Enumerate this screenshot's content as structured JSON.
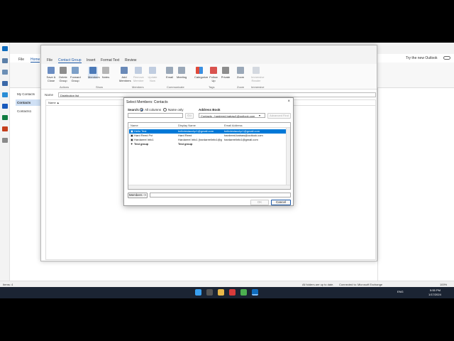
{
  "background": {
    "tabs": [
      "File",
      "Home"
    ],
    "try_new": "Try the new Outlook",
    "nav": {
      "my_contacts": "My Contacts",
      "contacts": "Contacts",
      "contacts1": "Contacts1"
    }
  },
  "contact_group_window": {
    "tabs": [
      "File",
      "Contact Group",
      "Insert",
      "Format Text",
      "Review"
    ],
    "ribbon_buttons": [
      {
        "label": "Save & Close"
      },
      {
        "label": "Delete Group"
      },
      {
        "label": "Forward Group"
      },
      {
        "label": "Members"
      },
      {
        "label": "Notes"
      },
      {
        "label": "Add Members"
      },
      {
        "label": "Remove Member"
      },
      {
        "label": "Update Now"
      },
      {
        "label": "Email"
      },
      {
        "label": "Meeting"
      },
      {
        "label": "Categorize"
      },
      {
        "label": "Follow Up"
      },
      {
        "label": "Private"
      },
      {
        "label": "Zoom"
      },
      {
        "label": "Immersive Reader"
      }
    ],
    "groups": [
      "Actions",
      "Show",
      "Members",
      "Communicate",
      "Tags",
      "Zoom",
      "Immersive"
    ],
    "name_label": "Name",
    "name_value": "Distribution list",
    "column_header": "Name ▲"
  },
  "dialog": {
    "title": "Select Members: Contacts",
    "search_label": "Search:",
    "radio_all": "All columns",
    "radio_name": "Name only",
    "go": "Go",
    "address_book_label": "Address Book",
    "address_book_value": "Contacts - hardreed.batraw1@outlook.com",
    "advanced_find": "Advanced Find",
    "columns": [
      "Name",
      "Display Name",
      "Email Address"
    ],
    "rows": [
      {
        "name": "Hello Test",
        "display": "hellotestacctyr1@gmail.com",
        "email": "hellotestacctyr1@gmail.com",
        "selected": true,
        "bold": false
      },
      {
        "name": "Hard Reed Pvt",
        "display": "Hard Reed",
        "email": "hardreed.batraw@outlook.com",
        "selected": false,
        "bold": false
      },
      {
        "name": "Hardareel Info1",
        "display": "Hardareel Info1 (hardareelinfo1@g...",
        "email": "hardareelinfo1@gmail.com",
        "selected": false,
        "bold": false
      },
      {
        "name": "Test group",
        "display": "Test group",
        "email": "",
        "selected": false,
        "bold": true
      }
    ],
    "members_button": "Members ->",
    "ok": "OK",
    "cancel": "Cancel"
  },
  "status": {
    "items": "Items: 4",
    "folders": "All folders are up to date.",
    "connected": "Connected to: Microsoft Exchange",
    "zoom": "100%"
  },
  "taskbar": {
    "lang": "ENG",
    "time": "5:55 PM",
    "date": "1/17/2024"
  }
}
